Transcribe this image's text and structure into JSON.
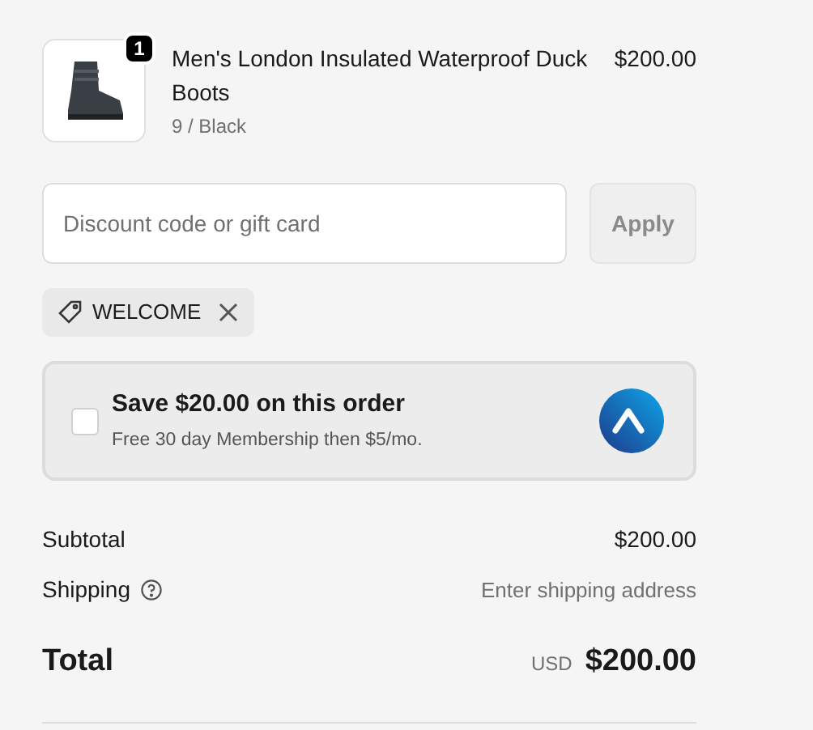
{
  "cart_item": {
    "quantity": "1",
    "title": "Men's London Insulated Waterproof Duck Boots",
    "variant": "9 / Black",
    "price": "$200.00"
  },
  "discount": {
    "placeholder": "Discount code or gift card",
    "button": "Apply",
    "disabled": true
  },
  "applied_codes": [
    {
      "code": "WELCOME"
    }
  ],
  "membership_offer": {
    "checked": false,
    "title": "Save $20.00 on this order",
    "subtitle": "Free 30 day Membership then $5/mo."
  },
  "summary": {
    "subtotal_label": "Subtotal",
    "subtotal": "$200.00",
    "shipping_label": "Shipping",
    "shipping": "Enter shipping address",
    "total_label": "Total",
    "currency": "USD",
    "total": "$200.00"
  }
}
